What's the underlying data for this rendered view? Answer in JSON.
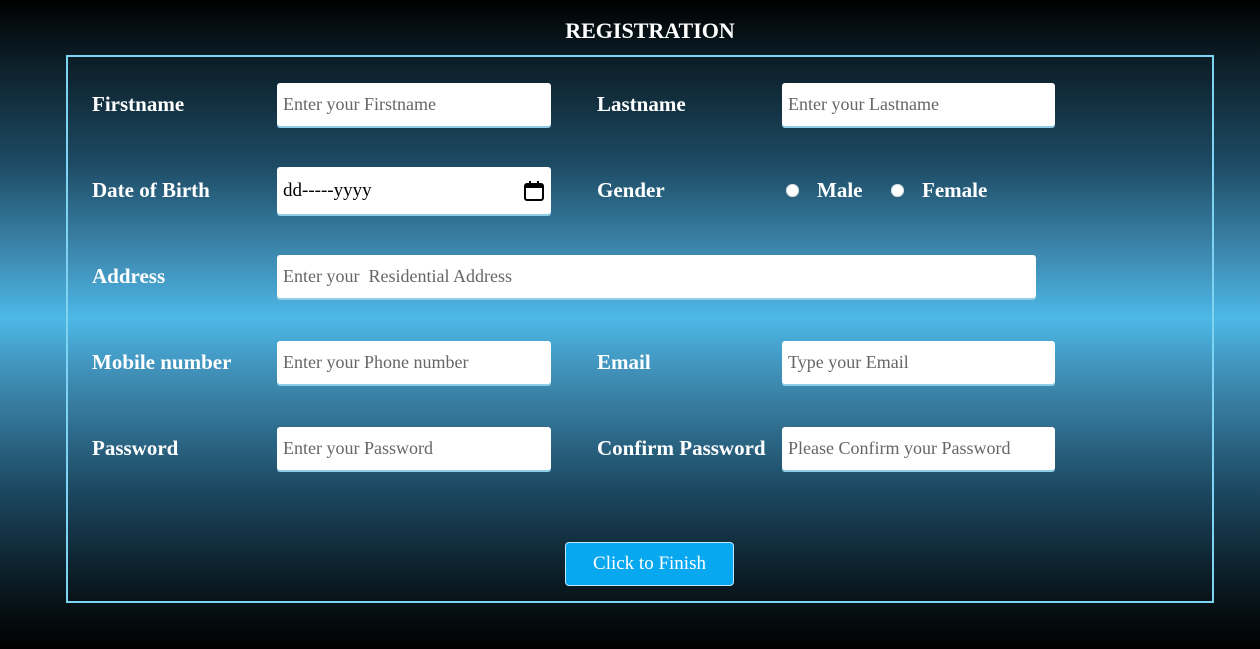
{
  "header": {
    "title": "REGISTRATION"
  },
  "form": {
    "firstname": {
      "label": "Firstname",
      "placeholder": "Enter your Firstname"
    },
    "lastname": {
      "label": "Lastname",
      "placeholder": "Enter your Lastname"
    },
    "dob": {
      "label": "Date of Birth",
      "value": "dd-----yyyy",
      "icon": "calendar-icon"
    },
    "gender": {
      "label": "Gender",
      "options": [
        {
          "label": "Male",
          "selected": false
        },
        {
          "label": "Female",
          "selected": false
        }
      ]
    },
    "address": {
      "label": "Address",
      "placeholder": "Enter your  Residential Address"
    },
    "mobile": {
      "label": "Mobile number",
      "placeholder": "Enter your Phone number"
    },
    "email": {
      "label": "Email",
      "placeholder": "Type your Email"
    },
    "password": {
      "label": "Password",
      "placeholder": "Enter your Password"
    },
    "confirm_password": {
      "label": "Confirm Password",
      "placeholder": "Please Confirm your Password"
    },
    "submit_label": "Click to Finish"
  },
  "colors": {
    "accent": "#08a8f0",
    "border": "#7fd3f2",
    "text": "#ffffff"
  }
}
